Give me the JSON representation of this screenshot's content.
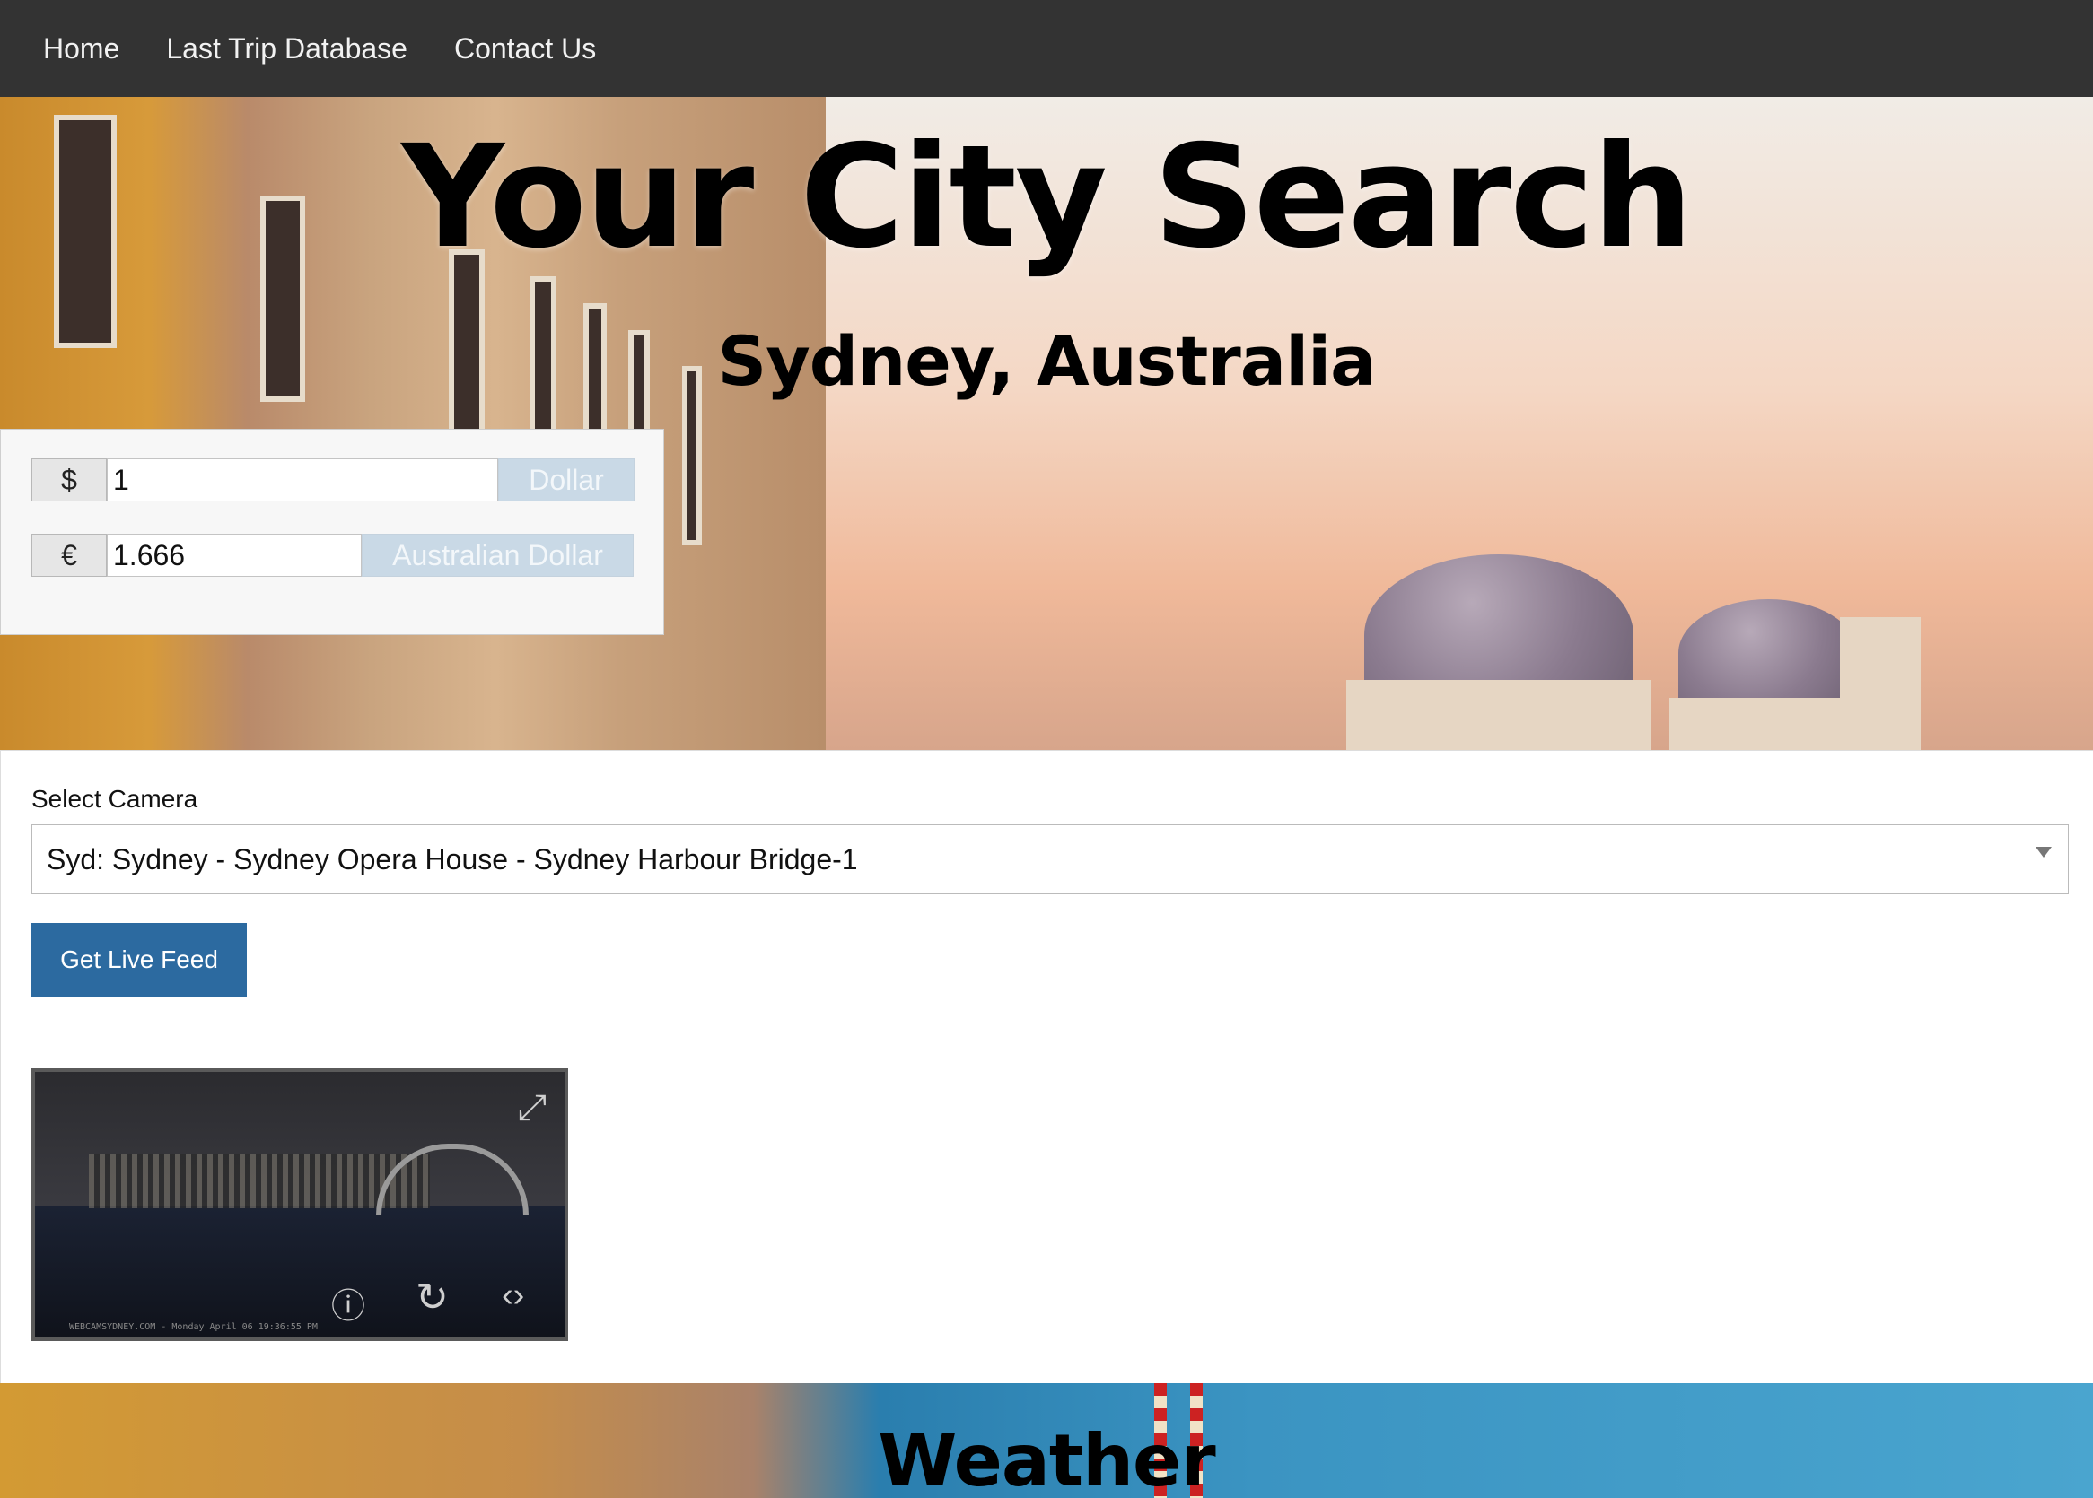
{
  "nav": {
    "items": [
      "Home",
      "Last Trip Database",
      "Contact Us"
    ]
  },
  "hero": {
    "title": "Your City Search",
    "subtitle": "Sydney, Australia"
  },
  "currency": {
    "from": {
      "symbol": "$",
      "value": "1",
      "label": "Dollar"
    },
    "to": {
      "symbol": "€",
      "value": "1.666",
      "label": "Australian Dollar"
    }
  },
  "camera": {
    "label": "Select Camera",
    "selected": "Syd: Sydney - Sydney Opera House - Sydney Harbour Bridge-1",
    "button": "Get Live Feed",
    "feed_caption": "WEBCAMSYDNEY.COM - Monday April 06 19:36:55 PM"
  },
  "weather": {
    "title": "Weather"
  },
  "icons": [
    "expand-icon",
    "info-icon",
    "replay-icon",
    "embed-icon",
    "chevron-down-icon"
  ]
}
